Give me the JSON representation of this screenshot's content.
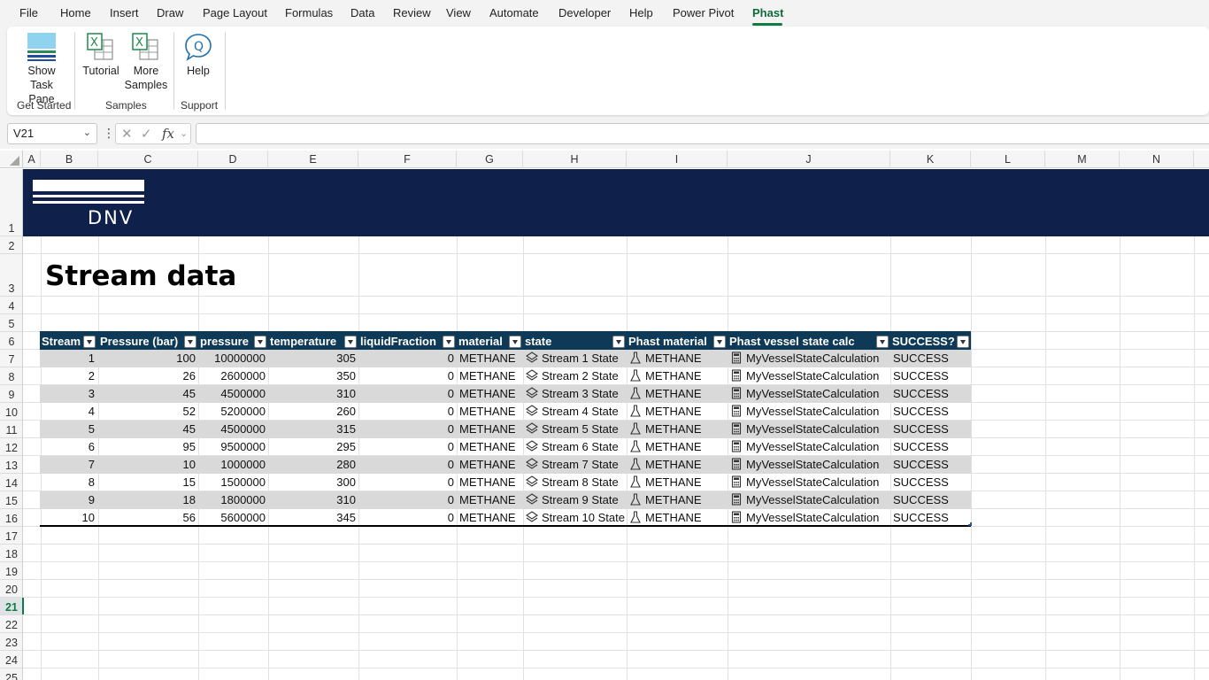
{
  "menu": {
    "tabs": [
      "File",
      "Home",
      "Insert",
      "Draw",
      "Page Layout",
      "Formulas",
      "Data",
      "Review",
      "View",
      "Automate",
      "Developer",
      "Help",
      "Power Pivot",
      "Phast"
    ],
    "active": "Phast"
  },
  "ribbon": {
    "show_task_pane": "Show\nTask Pane",
    "tutorial": "Tutorial",
    "more_samples": "More\nSamples",
    "help": "Help",
    "groups": [
      "Get Started",
      "Samples",
      "Support"
    ]
  },
  "formula_bar": {
    "name_box": "V21",
    "fx": "fx",
    "value": ""
  },
  "columns": [
    "A",
    "B",
    "C",
    "D",
    "E",
    "F",
    "G",
    "H",
    "I",
    "J",
    "K",
    "L",
    "M",
    "N"
  ],
  "rows": [
    "1",
    "2",
    "3",
    "4",
    "5",
    "6",
    "7",
    "8",
    "9",
    "10",
    "11",
    "12",
    "13",
    "14",
    "15",
    "16",
    "17",
    "18",
    "19",
    "20",
    "21",
    "22",
    "23",
    "24",
    "25"
  ],
  "selected_row": "21",
  "banner": {
    "logo_text": "DNV",
    "color": "#0f204b"
  },
  "sheet_title": "Stream data",
  "table": {
    "headers": [
      "Stream",
      "Pressure (bar)",
      "pressure",
      "temperature",
      "liquidFraction",
      "material",
      "state",
      "Phast material",
      "Phast vessel state calc",
      "SUCCESS?"
    ],
    "header_color": "#0f3a57",
    "rows": [
      [
        "1",
        "100",
        "10000000",
        "305",
        "0",
        "METHANE",
        "Stream 1 State",
        "METHANE",
        "MyVesselStateCalculation",
        "SUCCESS"
      ],
      [
        "2",
        "26",
        "2600000",
        "350",
        "0",
        "METHANE",
        "Stream 2 State",
        "METHANE",
        "MyVesselStateCalculation",
        "SUCCESS"
      ],
      [
        "3",
        "45",
        "4500000",
        "310",
        "0",
        "METHANE",
        "Stream 3 State",
        "METHANE",
        "MyVesselStateCalculation",
        "SUCCESS"
      ],
      [
        "4",
        "52",
        "5200000",
        "260",
        "0",
        "METHANE",
        "Stream 4 State",
        "METHANE",
        "MyVesselStateCalculation",
        "SUCCESS"
      ],
      [
        "5",
        "45",
        "4500000",
        "315",
        "0",
        "METHANE",
        "Stream 5 State",
        "METHANE",
        "MyVesselStateCalculation",
        "SUCCESS"
      ],
      [
        "6",
        "95",
        "9500000",
        "295",
        "0",
        "METHANE",
        "Stream 6 State",
        "METHANE",
        "MyVesselStateCalculation",
        "SUCCESS"
      ],
      [
        "7",
        "10",
        "1000000",
        "280",
        "0",
        "METHANE",
        "Stream 7 State",
        "METHANE",
        "MyVesselStateCalculation",
        "SUCCESS"
      ],
      [
        "8",
        "15",
        "1500000",
        "300",
        "0",
        "METHANE",
        "Stream 8 State",
        "METHANE",
        "MyVesselStateCalculation",
        "SUCCESS"
      ],
      [
        "9",
        "18",
        "1800000",
        "310",
        "0",
        "METHANE",
        "Stream 9 State",
        "METHANE",
        "MyVesselStateCalculation",
        "SUCCESS"
      ],
      [
        "10",
        "56",
        "5600000",
        "345",
        "0",
        "METHANE",
        "Stream 10 State",
        "METHANE",
        "MyVesselStateCalculation",
        "SUCCESS"
      ]
    ]
  },
  "icons": {
    "state": "layers-icon",
    "material": "flask-icon",
    "calc": "calculator-icon"
  }
}
